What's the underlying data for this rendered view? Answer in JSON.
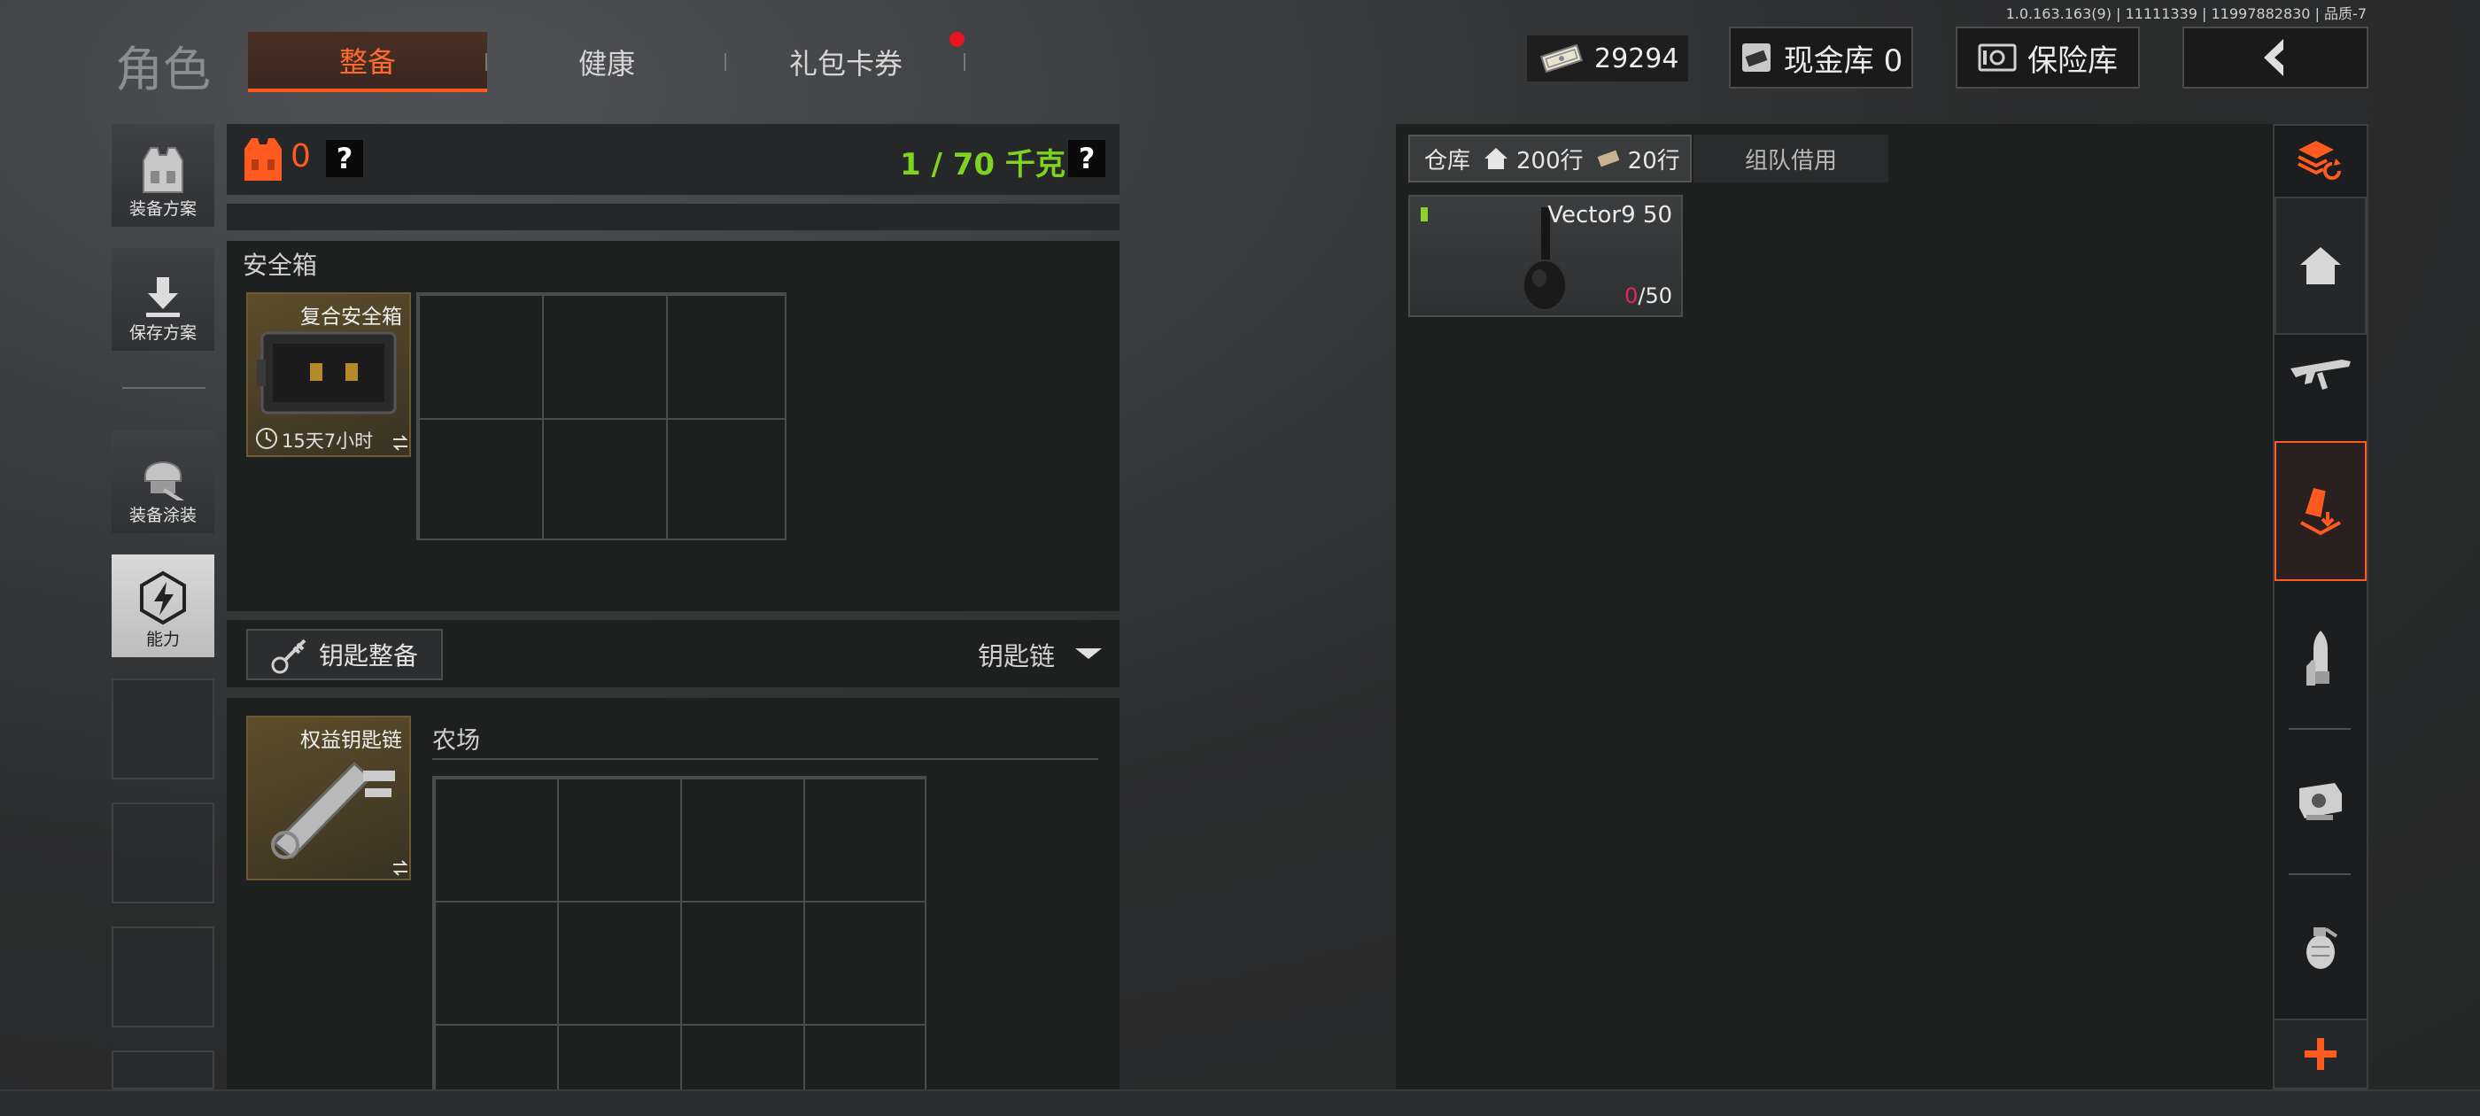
{
  "version": "1.0.163.163(9) | 11111339 | 11997882830 | 品质-7",
  "title": "角色",
  "tabs": [
    {
      "label": "整备"
    },
    {
      "label": "健康"
    },
    {
      "label": "礼包卡券"
    }
  ],
  "currency": "29294",
  "cash_vault": "现金库 0",
  "safe_vault": "保险库",
  "sidebar": [
    {
      "label": "装备方案",
      "icon": "vest-icon"
    },
    {
      "label": "保存方案",
      "icon": "download-icon"
    },
    {
      "label": "装备涂装",
      "icon": "helmet-icon"
    },
    {
      "label": "能力",
      "icon": "ability-icon"
    }
  ],
  "gear": {
    "count": "0",
    "help": "?",
    "weight": "1 / 70 千克"
  },
  "safe_box": {
    "section": "安全箱",
    "item_name": "复合安全箱",
    "timer": "15天7小时"
  },
  "keys": {
    "button": "钥匙整备",
    "dropdown": "钥匙链",
    "item_name": "权益钥匙链",
    "area": "农场"
  },
  "warehouse": {
    "tab_label": "仓库",
    "rows_home": "200行",
    "rows_ticket": "20行",
    "team_tab": "组队借用",
    "item": {
      "name": "Vector9 50",
      "count_current": "0",
      "count_total": "/50"
    }
  },
  "right_bar": [
    "stack-refresh-icon",
    "home-icon",
    "rifle-icon",
    "magazine-icon",
    "ammo-icon",
    "scope-icon",
    "grenade-icon",
    "plus-icon"
  ],
  "colors": {
    "accent": "#ff5a1f",
    "weight_green": "#7ed321",
    "count_red": "#e8245a"
  }
}
